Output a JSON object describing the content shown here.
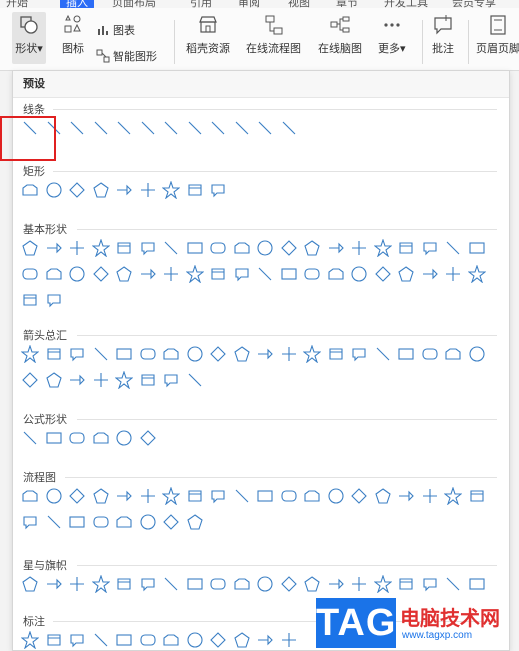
{
  "menubar": {
    "items": [
      "开始",
      "插入",
      "页面布局",
      "引用",
      "审阅",
      "视图",
      "章节",
      "开发工具",
      "会员专享"
    ],
    "active_index": 1
  },
  "ribbon": {
    "shapes_label": "形状",
    "icons_label": "图标",
    "chart_label": "图表",
    "smartart_label": "智能图形",
    "stock_label": "稻壳资源",
    "flowchart_label": "在线流程图",
    "mindmap_label": "在线脑图",
    "more_label": "更多",
    "comment_label": "批注",
    "header_footer_label": "页眉页脚"
  },
  "panel": {
    "header": "预设",
    "sections": [
      {
        "title": "线条",
        "count": 12
      },
      {
        "title": "矩形",
        "count": 9
      },
      {
        "title": "基本形状",
        "count": 42
      },
      {
        "title": "箭头总汇",
        "count": 28
      },
      {
        "title": "公式形状",
        "count": 6
      },
      {
        "title": "流程图",
        "count": 28
      },
      {
        "title": "星与旗帜",
        "count": 20
      },
      {
        "title": "标注",
        "count": 12
      }
    ]
  },
  "watermark": {
    "tag": "TAG",
    "site": "电脑技术网",
    "url": "www.tagxp.com"
  },
  "colors": {
    "shape_stroke": "#3b7fc4",
    "highlight": "#e02020",
    "accent": "#2b6cf6"
  }
}
